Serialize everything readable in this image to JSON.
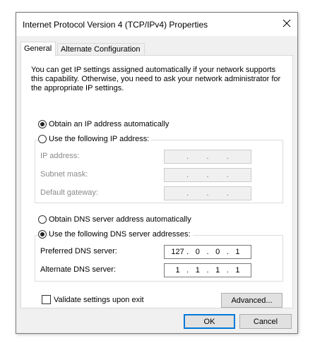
{
  "window": {
    "title": "Internet Protocol Version 4 (TCP/IPv4) Properties",
    "close_icon": "close-icon"
  },
  "tabs": [
    {
      "label": "General",
      "active": true
    },
    {
      "label": "Alternate Configuration",
      "active": false
    }
  ],
  "intro_text": "You can get IP settings assigned automatically if your network supports this capability. Otherwise, you need to ask your network administrator for the appropriate IP settings.",
  "ip": {
    "auto_label": "Obtain an IP address automatically",
    "auto_selected": true,
    "manual_label": "Use the following IP address:",
    "fields": [
      {
        "label": "IP address:",
        "value": [
          "",
          "",
          "",
          ""
        ]
      },
      {
        "label": "Subnet mask:",
        "value": [
          "",
          "",
          "",
          ""
        ]
      },
      {
        "label": "Default gateway:",
        "value": [
          "",
          "",
          "",
          ""
        ]
      }
    ]
  },
  "dns": {
    "auto_label": "Obtain DNS server address automatically",
    "manual_label": "Use the following DNS server addresses:",
    "manual_selected": true,
    "preferred_label": "Preferred DNS server:",
    "preferred_value": [
      "127",
      "0",
      "0",
      "1"
    ],
    "alternate_label": "Alternate DNS server:",
    "alternate_value": [
      "1",
      "1",
      "1",
      "1"
    ]
  },
  "validate_label": "Validate settings upon exit",
  "validate_checked": false,
  "advanced_label": "Advanced...",
  "ok_label": "OK",
  "cancel_label": "Cancel"
}
